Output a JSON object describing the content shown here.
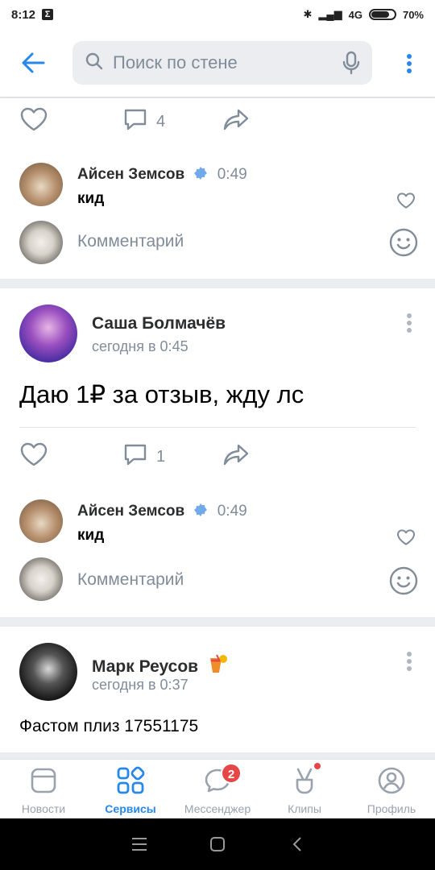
{
  "status": {
    "time": "8:12",
    "app_badge": "Σ",
    "network": "4G",
    "battery": "70%"
  },
  "header": {
    "search_placeholder": "Поиск по стене"
  },
  "post0": {
    "comments_count": "4"
  },
  "comment_a": {
    "author": "Айсен Земсов",
    "time": "0:49",
    "text": "кид"
  },
  "comment_input": {
    "placeholder": "Комментарий"
  },
  "post1": {
    "author": "Саша Болмачёв",
    "date": "сегодня в 0:45",
    "text": "Даю 1₽ за отзыв, жду лс",
    "comments_count": "1"
  },
  "comment_b": {
    "author": "Айсен Земсов",
    "time": "0:49",
    "text": "кид"
  },
  "comment_input2": {
    "placeholder": "Комментарий"
  },
  "post2": {
    "author": "Марк Реусов",
    "date": "сегодня в 0:37",
    "text": "Фастом плиз 17551175"
  },
  "tabbar": {
    "news": "Новости",
    "services": "Сервисы",
    "messenger": "Мессенджер",
    "messenger_badge": "2",
    "clips": "Клипы",
    "profile": "Профиль"
  },
  "colors": {
    "accent": "#2688eb",
    "muted": "#818c99",
    "badge": "#e64646"
  },
  "icons": [
    "back-arrow-icon",
    "search-icon",
    "mic-icon",
    "more-vertical-icon",
    "heart-icon",
    "comment-icon",
    "share-icon",
    "verified-icon",
    "smile-icon",
    "news-icon",
    "services-icon",
    "messenger-icon",
    "clips-icon",
    "profile-icon"
  ]
}
